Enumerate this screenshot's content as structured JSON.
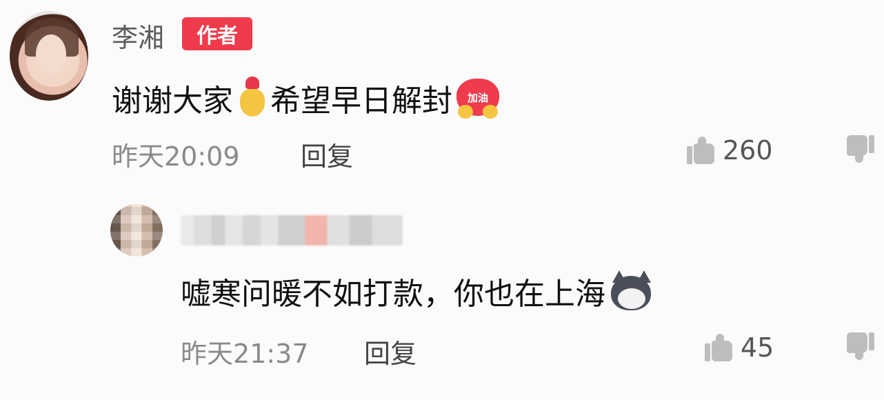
{
  "comments": [
    {
      "author": "李湘",
      "badge": "作者",
      "text_before": "谢谢大家",
      "text_after": "希望早日解封",
      "emoji_1": "heart-hand-icon",
      "emoji_2": "jiayou-heart-icon",
      "emoji_2_label": "加油",
      "time": "昨天20:09",
      "reply_label": "回复",
      "likes": "260"
    },
    {
      "author_blurred": true,
      "text": "嘘寒问暖不如打款，你也在上海",
      "emoji": "husky-dog-icon",
      "time": "昨天21:37",
      "reply_label": "回复",
      "likes": "45"
    }
  ],
  "colors": {
    "badge_bg": "#ef3b4c",
    "meta_text": "#8a8a8a",
    "icon_gray": "#bdbdbd"
  }
}
